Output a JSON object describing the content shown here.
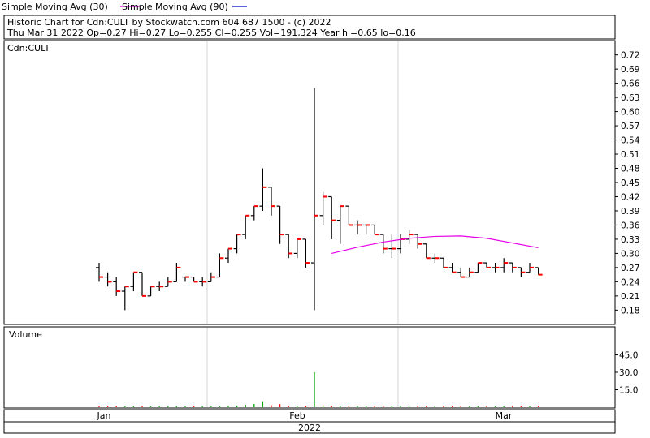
{
  "legend": {
    "sma30_label": "Simple Moving Avg (30)",
    "sma90_label": "Simple Moving Avg (90)",
    "sma30_color": "#e600e6",
    "sma90_color": "#0000cc"
  },
  "header": {
    "line1": "Historic Chart for Cdn:CULT by Stockwatch.com 604 687 1500 - (c) 2022",
    "line2": "Thu Mar 31 2022  Op=0.27  Hi=0.27  Lo=0.255  Cl=0.255  Vol=191,324  Year hi=0.65  lo=0.16"
  },
  "chart_data": {
    "type": "ohlc",
    "symbol": "Cdn:CULT",
    "price_ylim": [
      0.16,
      0.74
    ],
    "price_ticks": [
      "0.72",
      "0.69",
      "0.66",
      "0.63",
      "0.60",
      "0.57",
      "0.54",
      "0.51",
      "0.48",
      "0.45",
      "0.42",
      "0.39",
      "0.36",
      "0.33",
      "0.30",
      "0.27",
      "0.24",
      "0.21",
      "0.18"
    ],
    "volume_label": "Volume",
    "volume_ticks": [
      "45.0",
      "30.0",
      "15.0"
    ],
    "volume_ylim": [
      0,
      60
    ],
    "x_month_labels": [
      "Jan",
      "Feb",
      "Mar"
    ],
    "x_year_label": "2022",
    "bar_color_up": "#000000",
    "bar_color_down": "#ff0000",
    "bars": [
      {
        "o": 0.27,
        "h": 0.28,
        "l": 0.24,
        "c": 0.25,
        "v": 0.3
      },
      {
        "o": 0.25,
        "h": 0.26,
        "l": 0.23,
        "c": 0.24,
        "v": 0.2
      },
      {
        "o": 0.24,
        "h": 0.25,
        "l": 0.21,
        "c": 0.22,
        "v": 0.3
      },
      {
        "o": 0.22,
        "h": 0.23,
        "l": 0.18,
        "c": 0.23,
        "v": 0.8
      },
      {
        "o": 0.23,
        "h": 0.26,
        "l": 0.22,
        "c": 0.26,
        "v": 0.4
      },
      {
        "o": 0.26,
        "h": 0.26,
        "l": 0.21,
        "c": 0.21,
        "v": 0.5
      },
      {
        "o": 0.21,
        "h": 0.23,
        "l": 0.21,
        "c": 0.23,
        "v": 0.3
      },
      {
        "o": 0.23,
        "h": 0.24,
        "l": 0.22,
        "c": 0.23,
        "v": 0.3
      },
      {
        "o": 0.23,
        "h": 0.25,
        "l": 0.23,
        "c": 0.24,
        "v": 0.2
      },
      {
        "o": 0.24,
        "h": 0.28,
        "l": 0.24,
        "c": 0.27,
        "v": 0.6
      },
      {
        "o": 0.25,
        "h": 0.25,
        "l": 0.24,
        "c": 0.25,
        "v": 0.3
      },
      {
        "o": 0.25,
        "h": 0.25,
        "l": 0.24,
        "c": 0.24,
        "v": 0.3
      },
      {
        "o": 0.24,
        "h": 0.25,
        "l": 0.23,
        "c": 0.24,
        "v": 0.2
      },
      {
        "o": 0.24,
        "h": 0.26,
        "l": 0.24,
        "c": 0.25,
        "v": 0.4
      },
      {
        "o": 0.25,
        "h": 0.3,
        "l": 0.25,
        "c": 0.29,
        "v": 0.9
      },
      {
        "o": 0.29,
        "h": 0.31,
        "l": 0.28,
        "c": 0.31,
        "v": 1.2
      },
      {
        "o": 0.31,
        "h": 0.34,
        "l": 0.3,
        "c": 0.34,
        "v": 1.5
      },
      {
        "o": 0.34,
        "h": 0.38,
        "l": 0.33,
        "c": 0.38,
        "v": 2.0
      },
      {
        "o": 0.38,
        "h": 0.4,
        "l": 0.37,
        "c": 0.4,
        "v": 2.8
      },
      {
        "o": 0.4,
        "h": 0.48,
        "l": 0.39,
        "c": 0.44,
        "v": 4.5
      },
      {
        "o": 0.44,
        "h": 0.44,
        "l": 0.38,
        "c": 0.4,
        "v": 1.8
      },
      {
        "o": 0.4,
        "h": 0.4,
        "l": 0.32,
        "c": 0.34,
        "v": 2.6
      },
      {
        "o": 0.34,
        "h": 0.34,
        "l": 0.29,
        "c": 0.3,
        "v": 1.4
      },
      {
        "o": 0.3,
        "h": 0.33,
        "l": 0.29,
        "c": 0.33,
        "v": 1.0
      },
      {
        "o": 0.33,
        "h": 0.33,
        "l": 0.27,
        "c": 0.28,
        "v": 1.2
      },
      {
        "o": 0.28,
        "h": 0.65,
        "l": 0.18,
        "c": 0.38,
        "v": 30.0
      },
      {
        "o": 0.38,
        "h": 0.43,
        "l": 0.36,
        "c": 0.42,
        "v": 1.8
      },
      {
        "o": 0.42,
        "h": 0.37,
        "l": 0.33,
        "c": 0.37,
        "v": 1.2
      },
      {
        "o": 0.37,
        "h": 0.4,
        "l": 0.32,
        "c": 0.4,
        "v": 1.0
      },
      {
        "o": 0.4,
        "h": 0.4,
        "l": 0.36,
        "c": 0.36,
        "v": 0.5
      },
      {
        "o": 0.36,
        "h": 0.37,
        "l": 0.34,
        "c": 0.36,
        "v": 0.5
      },
      {
        "o": 0.36,
        "h": 0.36,
        "l": 0.34,
        "c": 0.36,
        "v": 0.4
      },
      {
        "o": 0.36,
        "h": 0.36,
        "l": 0.34,
        "c": 0.34,
        "v": 0.3
      },
      {
        "o": 0.34,
        "h": 0.34,
        "l": 0.3,
        "c": 0.31,
        "v": 0.3
      },
      {
        "o": 0.31,
        "h": 0.34,
        "l": 0.29,
        "c": 0.31,
        "v": 0.4
      },
      {
        "o": 0.31,
        "h": 0.34,
        "l": 0.3,
        "c": 0.33,
        "v": 0.3
      },
      {
        "o": 0.33,
        "h": 0.35,
        "l": 0.32,
        "c": 0.34,
        "v": 0.4
      },
      {
        "o": 0.34,
        "h": 0.34,
        "l": 0.31,
        "c": 0.32,
        "v": 0.3
      },
      {
        "o": 0.32,
        "h": 0.32,
        "l": 0.29,
        "c": 0.29,
        "v": 0.3
      },
      {
        "o": 0.29,
        "h": 0.3,
        "l": 0.28,
        "c": 0.29,
        "v": 0.3
      },
      {
        "o": 0.29,
        "h": 0.29,
        "l": 0.27,
        "c": 0.27,
        "v": 0.2
      },
      {
        "o": 0.27,
        "h": 0.28,
        "l": 0.26,
        "c": 0.26,
        "v": 0.4
      },
      {
        "o": 0.26,
        "h": 0.27,
        "l": 0.25,
        "c": 0.25,
        "v": 0.2
      },
      {
        "o": 0.25,
        "h": 0.27,
        "l": 0.25,
        "c": 0.26,
        "v": 0.2
      },
      {
        "o": 0.26,
        "h": 0.28,
        "l": 0.26,
        "c": 0.28,
        "v": 0.2
      },
      {
        "o": 0.28,
        "h": 0.28,
        "l": 0.27,
        "c": 0.27,
        "v": 0.2
      },
      {
        "o": 0.27,
        "h": 0.28,
        "l": 0.26,
        "c": 0.27,
        "v": 0.2
      },
      {
        "o": 0.27,
        "h": 0.29,
        "l": 0.26,
        "c": 0.28,
        "v": 0.3
      },
      {
        "o": 0.28,
        "h": 0.28,
        "l": 0.26,
        "c": 0.27,
        "v": 0.2
      },
      {
        "o": 0.27,
        "h": 0.27,
        "l": 0.25,
        "c": 0.26,
        "v": 0.2
      },
      {
        "o": 0.26,
        "h": 0.28,
        "l": 0.26,
        "c": 0.27,
        "v": 0.2
      },
      {
        "o": 0.27,
        "h": 0.27,
        "l": 0.255,
        "c": 0.255,
        "v": 0.2
      }
    ],
    "sma30": [
      {
        "i": 27,
        "v": 0.3
      },
      {
        "i": 30,
        "v": 0.313
      },
      {
        "i": 33,
        "v": 0.324
      },
      {
        "i": 36,
        "v": 0.332
      },
      {
        "i": 39,
        "v": 0.336
      },
      {
        "i": 42,
        "v": 0.337
      },
      {
        "i": 45,
        "v": 0.332
      },
      {
        "i": 48,
        "v": 0.322
      },
      {
        "i": 51,
        "v": 0.312
      }
    ]
  }
}
